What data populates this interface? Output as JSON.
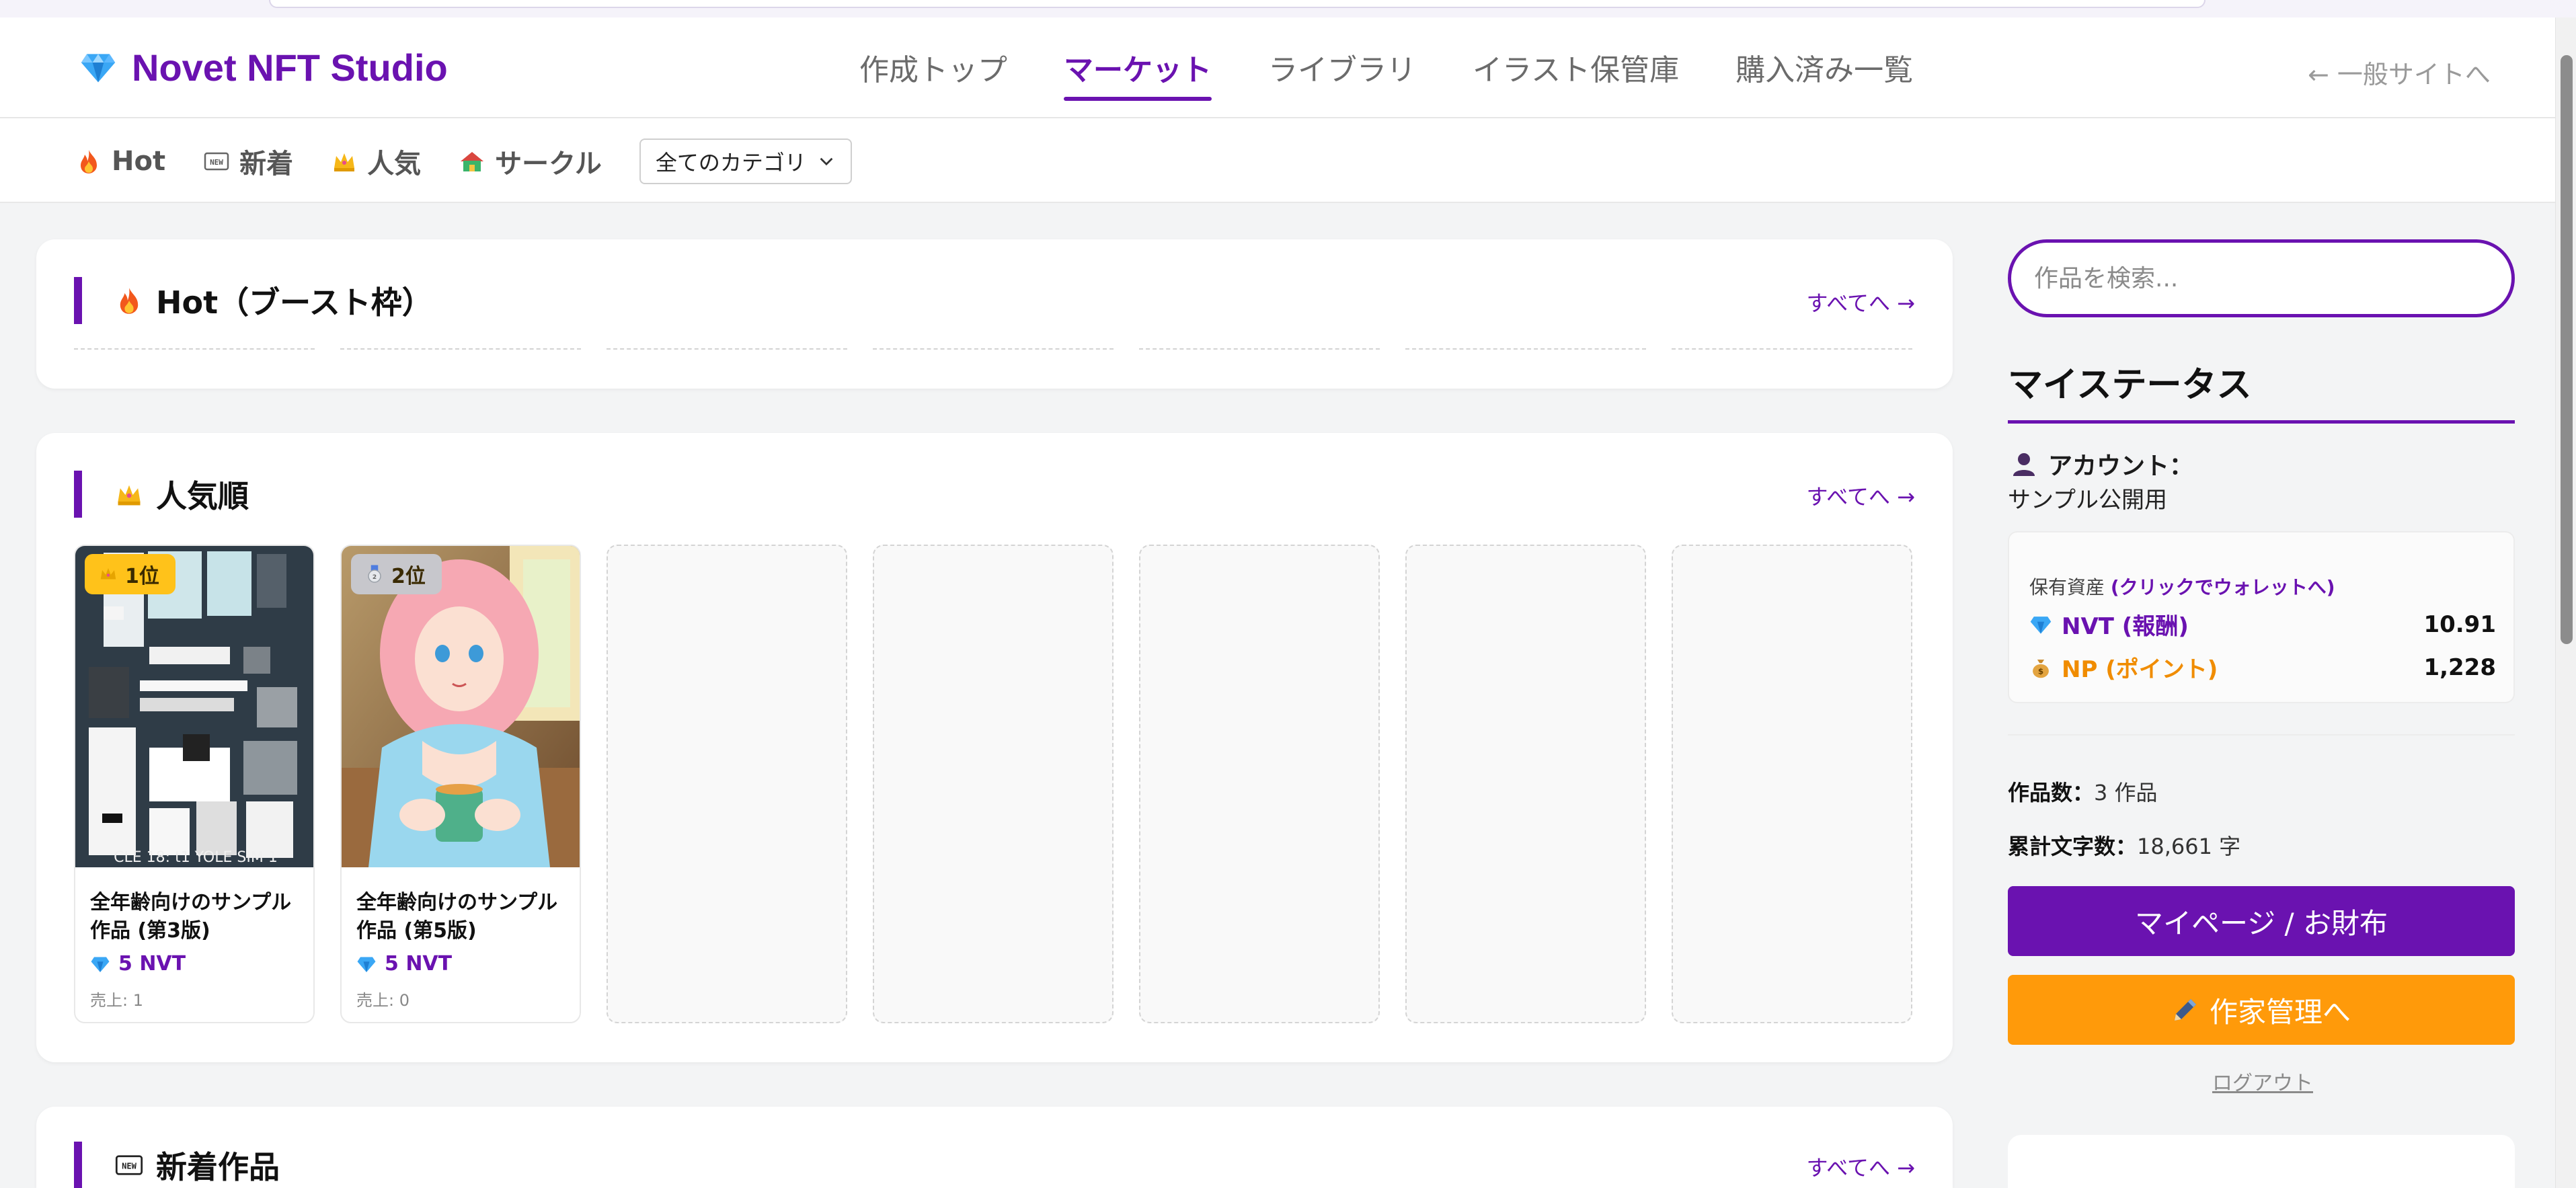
{
  "app": {
    "name": "Novet NFT Studio"
  },
  "nav": {
    "items": [
      {
        "label": "作成トップ",
        "active": false
      },
      {
        "label": "マーケット",
        "active": true
      },
      {
        "label": "ライブラリ",
        "active": false
      },
      {
        "label": "イラスト保管庫",
        "active": false
      },
      {
        "label": "購入済み一覧",
        "active": false
      }
    ],
    "back_link": "← 一般サイトへ"
  },
  "subnav": {
    "items": [
      {
        "label": "Hot",
        "icon": "fire-icon"
      },
      {
        "label": "新着",
        "icon": "new-icon"
      },
      {
        "label": "人気",
        "icon": "crown-icon"
      },
      {
        "label": "サークル",
        "icon": "house-icon"
      }
    ],
    "category_select": "全てのカテゴリ"
  },
  "sections": {
    "hot": {
      "title": "Hot（ブースト枠）",
      "see_all": "すべてへ →"
    },
    "popular": {
      "title": "人気順",
      "see_all": "すべてへ →",
      "works": [
        {
          "rank": "1位",
          "title": "全年齢向けのサンプル作品 (第3版)",
          "price": "5 NVT",
          "sales": "売上: 1",
          "thumb_text": "CLE 18: t1 YOLE SIM 1"
        },
        {
          "rank": "2位",
          "title": "全年齢向けのサンプル作品 (第5版)",
          "price": "5 NVT",
          "sales": "売上: 0"
        }
      ]
    },
    "new": {
      "title": "新着作品",
      "see_all": "すべてへ →"
    }
  },
  "sidebar": {
    "search_placeholder": "作品を検索...",
    "heading": "マイステータス",
    "account_label": "アカウント：",
    "account_value": "サンプル公開用",
    "assets_label": "保有資産",
    "assets_link": "(クリックでウォレットへ)",
    "assets": [
      {
        "label": "NVT (報酬)",
        "amount": "10.91",
        "color": "#6a12b0"
      },
      {
        "label": "NP (ポイント)",
        "amount": "1,228",
        "color": "#f08c00"
      }
    ],
    "stats": {
      "works_label": "作品数：",
      "works_value": "3 作品",
      "chars_label": "累計文字数：",
      "chars_value": "18,661 字"
    },
    "mypage_button": "マイページ / お財布",
    "author_button": "作家管理へ",
    "logout": "ログアウト"
  },
  "colors": {
    "accent": "#6a12b0",
    "orange": "#ff9a0a",
    "gold_badge": "#ffc21a"
  }
}
